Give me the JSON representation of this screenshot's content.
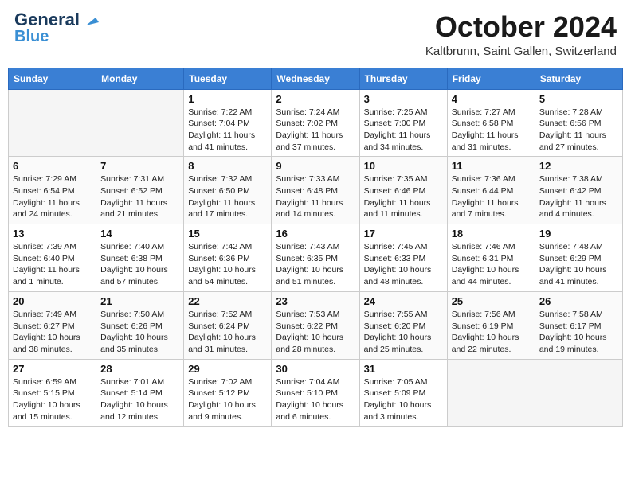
{
  "header": {
    "logo_line1": "General",
    "logo_line2": "Blue",
    "month": "October 2024",
    "location": "Kaltbrunn, Saint Gallen, Switzerland"
  },
  "days_of_week": [
    "Sunday",
    "Monday",
    "Tuesday",
    "Wednesday",
    "Thursday",
    "Friday",
    "Saturday"
  ],
  "weeks": [
    [
      {
        "day": "",
        "info": ""
      },
      {
        "day": "",
        "info": ""
      },
      {
        "day": "1",
        "info": "Sunrise: 7:22 AM\nSunset: 7:04 PM\nDaylight: 11 hours and 41 minutes."
      },
      {
        "day": "2",
        "info": "Sunrise: 7:24 AM\nSunset: 7:02 PM\nDaylight: 11 hours and 37 minutes."
      },
      {
        "day": "3",
        "info": "Sunrise: 7:25 AM\nSunset: 7:00 PM\nDaylight: 11 hours and 34 minutes."
      },
      {
        "day": "4",
        "info": "Sunrise: 7:27 AM\nSunset: 6:58 PM\nDaylight: 11 hours and 31 minutes."
      },
      {
        "day": "5",
        "info": "Sunrise: 7:28 AM\nSunset: 6:56 PM\nDaylight: 11 hours and 27 minutes."
      }
    ],
    [
      {
        "day": "6",
        "info": "Sunrise: 7:29 AM\nSunset: 6:54 PM\nDaylight: 11 hours and 24 minutes."
      },
      {
        "day": "7",
        "info": "Sunrise: 7:31 AM\nSunset: 6:52 PM\nDaylight: 11 hours and 21 minutes."
      },
      {
        "day": "8",
        "info": "Sunrise: 7:32 AM\nSunset: 6:50 PM\nDaylight: 11 hours and 17 minutes."
      },
      {
        "day": "9",
        "info": "Sunrise: 7:33 AM\nSunset: 6:48 PM\nDaylight: 11 hours and 14 minutes."
      },
      {
        "day": "10",
        "info": "Sunrise: 7:35 AM\nSunset: 6:46 PM\nDaylight: 11 hours and 11 minutes."
      },
      {
        "day": "11",
        "info": "Sunrise: 7:36 AM\nSunset: 6:44 PM\nDaylight: 11 hours and 7 minutes."
      },
      {
        "day": "12",
        "info": "Sunrise: 7:38 AM\nSunset: 6:42 PM\nDaylight: 11 hours and 4 minutes."
      }
    ],
    [
      {
        "day": "13",
        "info": "Sunrise: 7:39 AM\nSunset: 6:40 PM\nDaylight: 11 hours and 1 minute."
      },
      {
        "day": "14",
        "info": "Sunrise: 7:40 AM\nSunset: 6:38 PM\nDaylight: 10 hours and 57 minutes."
      },
      {
        "day": "15",
        "info": "Sunrise: 7:42 AM\nSunset: 6:36 PM\nDaylight: 10 hours and 54 minutes."
      },
      {
        "day": "16",
        "info": "Sunrise: 7:43 AM\nSunset: 6:35 PM\nDaylight: 10 hours and 51 minutes."
      },
      {
        "day": "17",
        "info": "Sunrise: 7:45 AM\nSunset: 6:33 PM\nDaylight: 10 hours and 48 minutes."
      },
      {
        "day": "18",
        "info": "Sunrise: 7:46 AM\nSunset: 6:31 PM\nDaylight: 10 hours and 44 minutes."
      },
      {
        "day": "19",
        "info": "Sunrise: 7:48 AM\nSunset: 6:29 PM\nDaylight: 10 hours and 41 minutes."
      }
    ],
    [
      {
        "day": "20",
        "info": "Sunrise: 7:49 AM\nSunset: 6:27 PM\nDaylight: 10 hours and 38 minutes."
      },
      {
        "day": "21",
        "info": "Sunrise: 7:50 AM\nSunset: 6:26 PM\nDaylight: 10 hours and 35 minutes."
      },
      {
        "day": "22",
        "info": "Sunrise: 7:52 AM\nSunset: 6:24 PM\nDaylight: 10 hours and 31 minutes."
      },
      {
        "day": "23",
        "info": "Sunrise: 7:53 AM\nSunset: 6:22 PM\nDaylight: 10 hours and 28 minutes."
      },
      {
        "day": "24",
        "info": "Sunrise: 7:55 AM\nSunset: 6:20 PM\nDaylight: 10 hours and 25 minutes."
      },
      {
        "day": "25",
        "info": "Sunrise: 7:56 AM\nSunset: 6:19 PM\nDaylight: 10 hours and 22 minutes."
      },
      {
        "day": "26",
        "info": "Sunrise: 7:58 AM\nSunset: 6:17 PM\nDaylight: 10 hours and 19 minutes."
      }
    ],
    [
      {
        "day": "27",
        "info": "Sunrise: 6:59 AM\nSunset: 5:15 PM\nDaylight: 10 hours and 15 minutes."
      },
      {
        "day": "28",
        "info": "Sunrise: 7:01 AM\nSunset: 5:14 PM\nDaylight: 10 hours and 12 minutes."
      },
      {
        "day": "29",
        "info": "Sunrise: 7:02 AM\nSunset: 5:12 PM\nDaylight: 10 hours and 9 minutes."
      },
      {
        "day": "30",
        "info": "Sunrise: 7:04 AM\nSunset: 5:10 PM\nDaylight: 10 hours and 6 minutes."
      },
      {
        "day": "31",
        "info": "Sunrise: 7:05 AM\nSunset: 5:09 PM\nDaylight: 10 hours and 3 minutes."
      },
      {
        "day": "",
        "info": ""
      },
      {
        "day": "",
        "info": ""
      }
    ]
  ]
}
